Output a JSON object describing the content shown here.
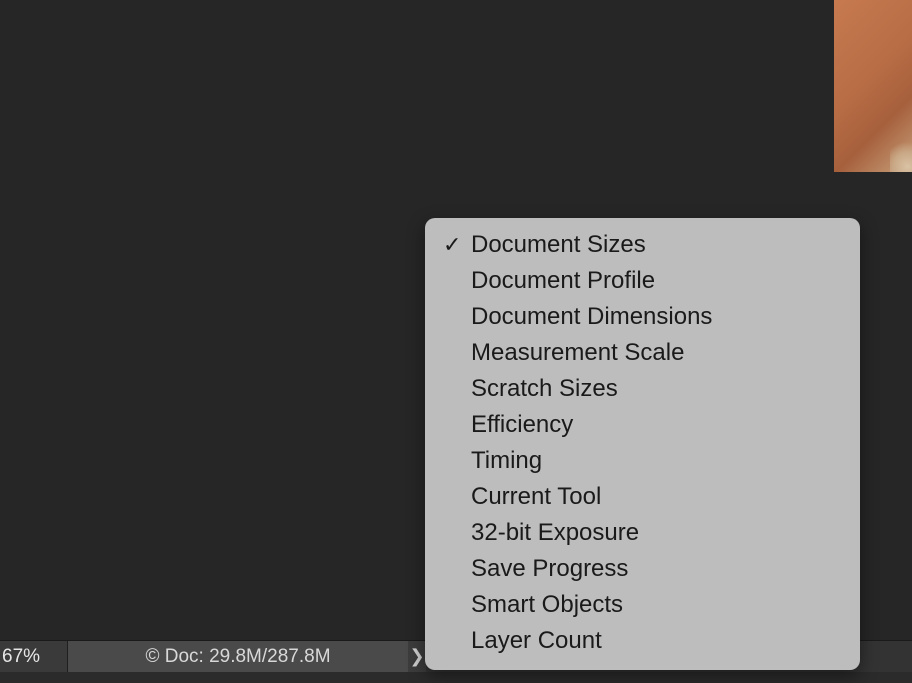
{
  "status_bar": {
    "zoom": "67%",
    "doc_info": "© Doc: 29.8M/287.8M",
    "arrow": "❯"
  },
  "menu": {
    "items": [
      {
        "label": "Document Sizes",
        "checked": true
      },
      {
        "label": "Document Profile",
        "checked": false
      },
      {
        "label": "Document Dimensions",
        "checked": false
      },
      {
        "label": "Measurement Scale",
        "checked": false
      },
      {
        "label": "Scratch Sizes",
        "checked": false
      },
      {
        "label": "Efficiency",
        "checked": false
      },
      {
        "label": "Timing",
        "checked": false
      },
      {
        "label": "Current Tool",
        "checked": false
      },
      {
        "label": "32-bit Exposure",
        "checked": false
      },
      {
        "label": "Save Progress",
        "checked": false
      },
      {
        "label": "Smart Objects",
        "checked": false
      },
      {
        "label": "Layer Count",
        "checked": false
      }
    ],
    "check_glyph": "✓"
  },
  "colors": {
    "workspace": "#262626",
    "menu_background": "#bdbdbd",
    "menu_text": "#1a1a1a",
    "status_doc_background": "#4a4a4a"
  }
}
